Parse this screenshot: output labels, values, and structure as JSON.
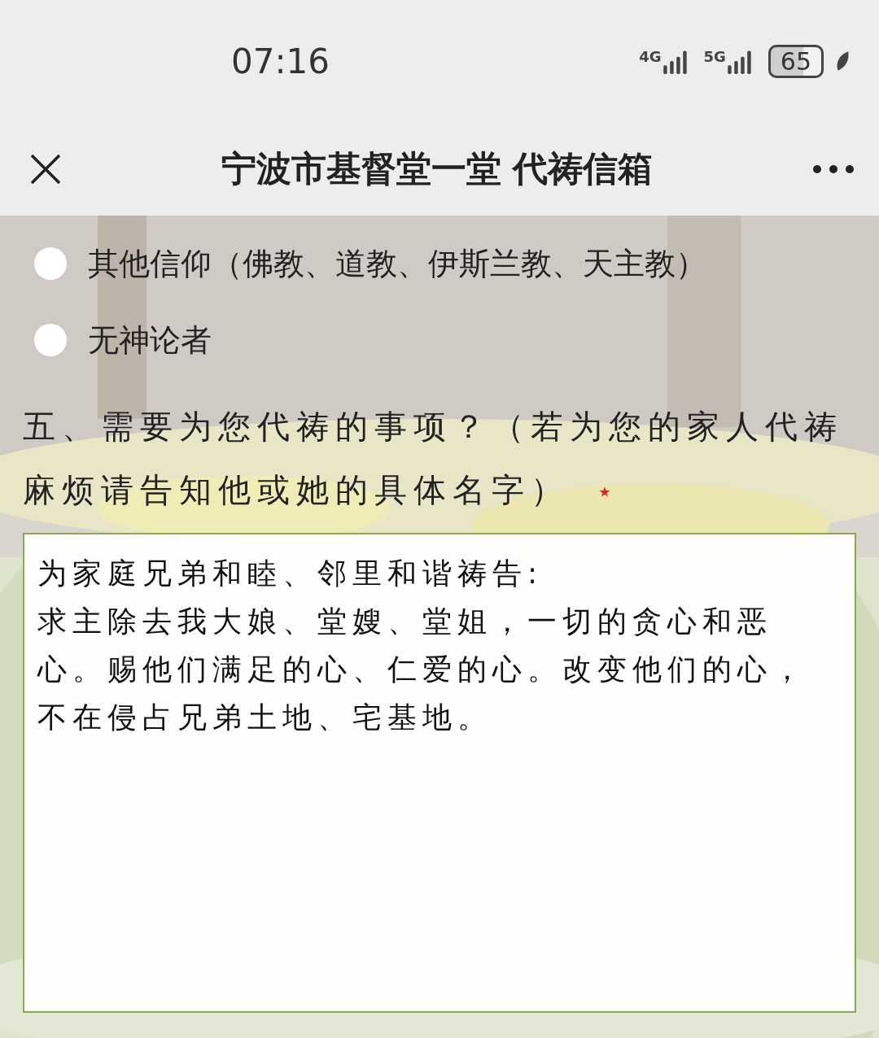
{
  "status_bar": {
    "time": "07:16",
    "networks": [
      "4G",
      "5G"
    ],
    "battery": "65"
  },
  "header": {
    "title": "宁波市基督堂一堂 代祷信箱"
  },
  "options": [
    {
      "label": "其他信仰（佛教、道教、伊斯兰教、天主教）",
      "selected": false
    },
    {
      "label": "无神论者",
      "selected": false
    }
  ],
  "question": {
    "label": "五、需要为您代祷的事项？（若为您的家人代祷麻烦请告知他或她的具体名字）",
    "required": true
  },
  "answer": {
    "value": "为家庭兄弟和睦、邻里和谐祷告:\n求主除去我大娘、堂嫂、堂姐，一切的贪心和恶心。赐他们满足的心、仁爱的心。改变他们的心，不在侵占兄弟土地、宅基地。"
  }
}
